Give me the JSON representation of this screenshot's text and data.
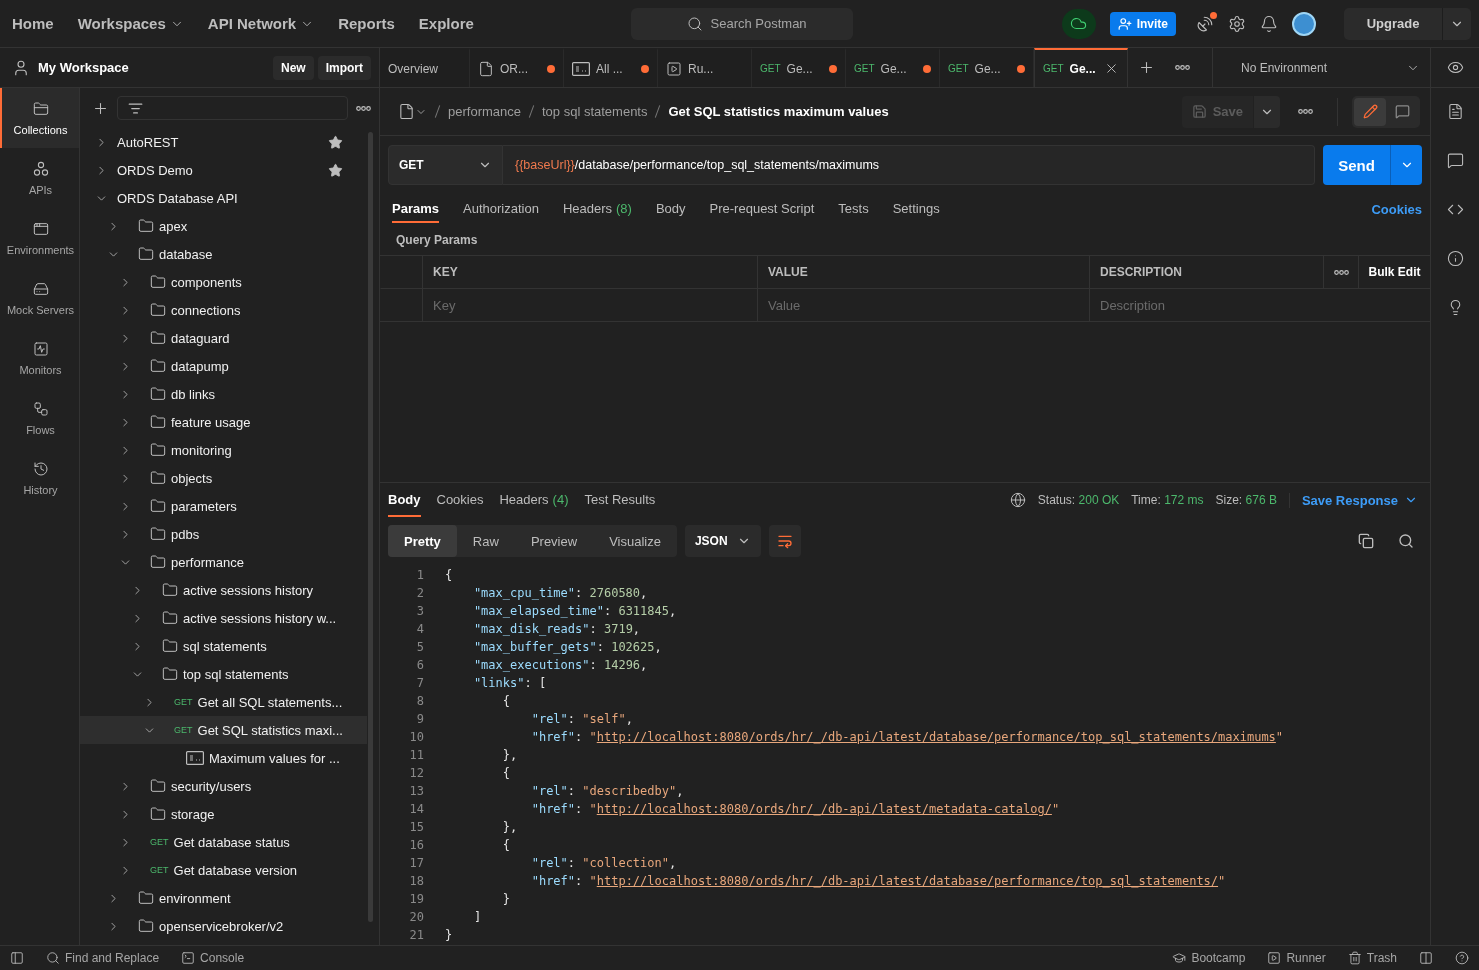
{
  "top_nav": {
    "items": [
      {
        "label": "Home",
        "dropdown": false
      },
      {
        "label": "Workspaces",
        "dropdown": true
      },
      {
        "label": "API Network",
        "dropdown": true
      },
      {
        "label": "Reports",
        "dropdown": false
      },
      {
        "label": "Explore",
        "dropdown": false
      }
    ],
    "search": {
      "placeholder": "Search Postman"
    },
    "invite": "Invite",
    "upgrade": "Upgrade",
    "notification_dot": true
  },
  "workspace": {
    "name": "My Workspace",
    "buttons": [
      "New",
      "Import"
    ]
  },
  "tabs": [
    {
      "kind": "overview",
      "label": "Overview",
      "unsaved": false,
      "selected": false
    },
    {
      "kind": "collection",
      "label": "OR...",
      "unsaved": true,
      "selected": false
    },
    {
      "kind": "example",
      "label": "All ...",
      "unsaved": true,
      "selected": false
    },
    {
      "kind": "runner",
      "label": "Ru...",
      "unsaved": false,
      "selected": false
    },
    {
      "kind": "request",
      "method": "GET",
      "label": "Ge...",
      "unsaved": true,
      "selected": false
    },
    {
      "kind": "request",
      "method": "GET",
      "label": "Ge...",
      "unsaved": true,
      "selected": false
    },
    {
      "kind": "request",
      "method": "GET",
      "label": "Ge...",
      "unsaved": true,
      "selected": false
    },
    {
      "kind": "request",
      "method": "GET",
      "label": "Ge...",
      "unsaved": false,
      "selected": true
    }
  ],
  "environment": {
    "label": "No Environment"
  },
  "sidebar": {
    "items": [
      {
        "kind": "collections",
        "label": "Collections",
        "selected": true
      },
      {
        "kind": "apis",
        "label": "APIs",
        "selected": false
      },
      {
        "kind": "environments",
        "label": "Environments",
        "selected": false
      },
      {
        "kind": "mocks",
        "label": "Mock Servers",
        "selected": false
      },
      {
        "kind": "monitors",
        "label": "Monitors",
        "selected": false
      },
      {
        "kind": "flows",
        "label": "Flows",
        "selected": false
      },
      {
        "kind": "history",
        "label": "History",
        "selected": false
      }
    ]
  },
  "collections": [
    {
      "kind": "collection",
      "label": "AutoREST",
      "expanded": false,
      "starred": true,
      "selected": false
    },
    {
      "kind": "collection",
      "label": "ORDS Demo",
      "expanded": false,
      "starred": true,
      "selected": false
    },
    {
      "kind": "collection",
      "label": "ORDS Database API",
      "expanded": true,
      "starred": false,
      "selected": false,
      "children": [
        {
          "kind": "folder",
          "label": "apex",
          "expanded": false,
          "selected": false
        },
        {
          "kind": "folder",
          "label": "database",
          "expanded": true,
          "selected": false,
          "children": [
            {
              "kind": "folder",
              "label": "components",
              "expanded": false,
              "selected": false
            },
            {
              "kind": "folder",
              "label": "connections",
              "expanded": false,
              "selected": false
            },
            {
              "kind": "folder",
              "label": "dataguard",
              "expanded": false,
              "selected": false
            },
            {
              "kind": "folder",
              "label": "datapump",
              "expanded": false,
              "selected": false
            },
            {
              "kind": "folder",
              "label": "db links",
              "expanded": false,
              "selected": false
            },
            {
              "kind": "folder",
              "label": "feature usage",
              "expanded": false,
              "selected": false
            },
            {
              "kind": "folder",
              "label": "monitoring",
              "expanded": false,
              "selected": false
            },
            {
              "kind": "folder",
              "label": "objects",
              "expanded": false,
              "selected": false
            },
            {
              "kind": "folder",
              "label": "parameters",
              "expanded": false,
              "selected": false
            },
            {
              "kind": "folder",
              "label": "pdbs",
              "expanded": false,
              "selected": false
            },
            {
              "kind": "folder",
              "label": "performance",
              "expanded": true,
              "selected": false,
              "children": [
                {
                  "kind": "folder",
                  "label": "active sessions history",
                  "expanded": false,
                  "selected": false
                },
                {
                  "kind": "folder",
                  "label": "active sessions history w...",
                  "expanded": false,
                  "selected": false
                },
                {
                  "kind": "folder",
                  "label": "sql statements",
                  "expanded": false,
                  "selected": false
                },
                {
                  "kind": "folder",
                  "label": "top sql statements",
                  "expanded": true,
                  "selected": false,
                  "children": [
                    {
                      "kind": "request",
                      "method": "GET",
                      "label": "Get all SQL statements...",
                      "expanded": false,
                      "selected": false
                    },
                    {
                      "kind": "request",
                      "method": "GET",
                      "label": "Get SQL statistics maxi...",
                      "expanded": true,
                      "selected": true,
                      "children": [
                        {
                          "kind": "example",
                          "label": "Maximum values for ...",
                          "selected": false
                        }
                      ]
                    }
                  ]
                }
              ]
            },
            {
              "kind": "folder",
              "label": "security/users",
              "expanded": false,
              "selected": false
            },
            {
              "kind": "folder",
              "label": "storage",
              "expanded": false,
              "selected": false
            },
            {
              "kind": "request",
              "method": "GET",
              "label": "Get database status",
              "expanded": false,
              "selected": false
            },
            {
              "kind": "request",
              "method": "GET",
              "label": "Get database version",
              "expanded": false,
              "selected": false
            }
          ]
        },
        {
          "kind": "folder",
          "label": "environment",
          "expanded": false,
          "selected": false
        },
        {
          "kind": "folder",
          "label": "openservicebroker/v2",
          "expanded": false,
          "selected": false
        }
      ]
    }
  ],
  "request": {
    "breadcrumb": [
      "performance",
      "top sql statements"
    ],
    "title": "Get SQL statistics maximum values",
    "save": {
      "label": "Save",
      "disabled": true
    },
    "modes": [
      {
        "kind": "edit",
        "selected": true
      },
      {
        "kind": "comments",
        "selected": false
      }
    ],
    "method": "GET",
    "url": {
      "variable": "{{baseUrl}}",
      "path": "/database/performance/top_sql_statements/maximums"
    },
    "send": "Send",
    "tabs": [
      {
        "label": "Params",
        "selected": true
      },
      {
        "label": "Authorization",
        "selected": false
      },
      {
        "label": "Headers",
        "count": "(8)",
        "selected": false
      },
      {
        "label": "Body",
        "selected": false
      },
      {
        "label": "Pre-request Script",
        "selected": false
      },
      {
        "label": "Tests",
        "selected": false
      },
      {
        "label": "Settings",
        "selected": false
      }
    ],
    "cookies": "Cookies",
    "query_params": {
      "title": "Query Params",
      "columns": [
        "KEY",
        "VALUE",
        "DESCRIPTION"
      ],
      "bulk_edit": "Bulk Edit",
      "placeholders": [
        "Key",
        "Value",
        "Description"
      ]
    }
  },
  "response": {
    "tabs": [
      {
        "label": "Body",
        "selected": true
      },
      {
        "label": "Cookies",
        "selected": false
      },
      {
        "label": "Headers",
        "count": "(4)",
        "selected": false
      },
      {
        "label": "Test Results",
        "selected": false
      }
    ],
    "status": [
      {
        "label": "Status:",
        "value": "200 OK"
      },
      {
        "label": "Time:",
        "value": "172 ms"
      },
      {
        "label": "Size:",
        "value": "676 B"
      }
    ],
    "save_response": "Save Response",
    "views": [
      {
        "label": "Pretty",
        "selected": true
      },
      {
        "label": "Raw",
        "selected": false
      },
      {
        "label": "Preview",
        "selected": false
      },
      {
        "label": "Visualize",
        "selected": false
      }
    ],
    "format": "JSON",
    "code": [
      {
        "number": "1",
        "tokens": [
          {
            "kind": "punct",
            "text": "{"
          }
        ]
      },
      {
        "number": "2",
        "tokens": [
          {
            "kind": "key",
            "text": "    \"max_cpu_time\""
          },
          {
            "kind": "punct",
            "text": ": "
          },
          {
            "kind": "number",
            "text": "2760580"
          },
          {
            "kind": "punct",
            "text": ","
          }
        ]
      },
      {
        "number": "3",
        "tokens": [
          {
            "kind": "key",
            "text": "    \"max_elapsed_time\""
          },
          {
            "kind": "punct",
            "text": ": "
          },
          {
            "kind": "number",
            "text": "6311845"
          },
          {
            "kind": "punct",
            "text": ","
          }
        ]
      },
      {
        "number": "4",
        "tokens": [
          {
            "kind": "key",
            "text": "    \"max_disk_reads\""
          },
          {
            "kind": "punct",
            "text": ": "
          },
          {
            "kind": "number",
            "text": "3719"
          },
          {
            "kind": "punct",
            "text": ","
          }
        ]
      },
      {
        "number": "5",
        "tokens": [
          {
            "kind": "key",
            "text": "    \"max_buffer_gets\""
          },
          {
            "kind": "punct",
            "text": ": "
          },
          {
            "kind": "number",
            "text": "102625"
          },
          {
            "kind": "punct",
            "text": ","
          }
        ]
      },
      {
        "number": "6",
        "tokens": [
          {
            "kind": "key",
            "text": "    \"max_executions\""
          },
          {
            "kind": "punct",
            "text": ": "
          },
          {
            "kind": "number",
            "text": "14296"
          },
          {
            "kind": "punct",
            "text": ","
          }
        ]
      },
      {
        "number": "7",
        "tokens": [
          {
            "kind": "key",
            "text": "    \"links\""
          },
          {
            "kind": "punct",
            "text": ": ["
          }
        ]
      },
      {
        "number": "8",
        "tokens": [
          {
            "kind": "punct",
            "text": "        {"
          }
        ]
      },
      {
        "number": "9",
        "tokens": [
          {
            "kind": "key",
            "text": "            \"rel\""
          },
          {
            "kind": "punct",
            "text": ": "
          },
          {
            "kind": "string",
            "text": "\"self\""
          },
          {
            "kind": "punct",
            "text": ","
          }
        ]
      },
      {
        "number": "10",
        "tokens": [
          {
            "kind": "key",
            "text": "            \"href\""
          },
          {
            "kind": "punct",
            "text": ": "
          },
          {
            "kind": "string",
            "text": "\""
          },
          {
            "kind": "link",
            "text": "http://localhost:8080/ords/hr/_/db-api/latest/database/performance/top_sql_statements/maximums"
          },
          {
            "kind": "string",
            "text": "\""
          }
        ]
      },
      {
        "number": "11",
        "tokens": [
          {
            "kind": "punct",
            "text": "        },"
          }
        ]
      },
      {
        "number": "12",
        "tokens": [
          {
            "kind": "punct",
            "text": "        {"
          }
        ]
      },
      {
        "number": "13",
        "tokens": [
          {
            "kind": "key",
            "text": "            \"rel\""
          },
          {
            "kind": "punct",
            "text": ": "
          },
          {
            "kind": "string",
            "text": "\"describedby\""
          },
          {
            "kind": "punct",
            "text": ","
          }
        ]
      },
      {
        "number": "14",
        "tokens": [
          {
            "kind": "key",
            "text": "            \"href\""
          },
          {
            "kind": "punct",
            "text": ": "
          },
          {
            "kind": "string",
            "text": "\""
          },
          {
            "kind": "link",
            "text": "http://localhost:8080/ords/hr/_/db-api/latest/metadata-catalog/"
          },
          {
            "kind": "string",
            "text": "\""
          }
        ]
      },
      {
        "number": "15",
        "tokens": [
          {
            "kind": "punct",
            "text": "        },"
          }
        ]
      },
      {
        "number": "16",
        "tokens": [
          {
            "kind": "punct",
            "text": "        {"
          }
        ]
      },
      {
        "number": "17",
        "tokens": [
          {
            "kind": "key",
            "text": "            \"rel\""
          },
          {
            "kind": "punct",
            "text": ": "
          },
          {
            "kind": "string",
            "text": "\"collection\""
          },
          {
            "kind": "punct",
            "text": ","
          }
        ]
      },
      {
        "number": "18",
        "tokens": [
          {
            "kind": "key",
            "text": "            \"href\""
          },
          {
            "kind": "punct",
            "text": ": "
          },
          {
            "kind": "string",
            "text": "\""
          },
          {
            "kind": "link",
            "text": "http://localhost:8080/ords/hr/_/db-api/latest/database/performance/top_sql_statements/"
          },
          {
            "kind": "string",
            "text": "\""
          }
        ]
      },
      {
        "number": "19",
        "tokens": [
          {
            "kind": "punct",
            "text": "        }"
          }
        ]
      },
      {
        "number": "20",
        "tokens": [
          {
            "kind": "punct",
            "text": "    ]"
          }
        ]
      },
      {
        "number": "21",
        "tokens": [
          {
            "kind": "punct",
            "text": "}"
          }
        ]
      }
    ]
  },
  "status_bar": {
    "left": [
      {
        "kind": "find",
        "label": "Find and Replace"
      },
      {
        "kind": "console",
        "label": "Console"
      }
    ],
    "right": [
      {
        "kind": "bootcamp",
        "label": "Bootcamp"
      },
      {
        "kind": "runner",
        "label": "Runner"
      },
      {
        "kind": "trash",
        "label": "Trash"
      }
    ]
  }
}
